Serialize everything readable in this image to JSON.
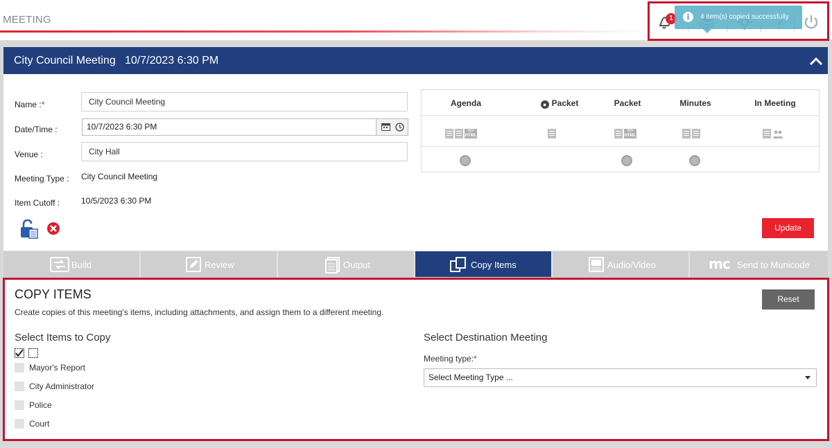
{
  "app": {
    "title": "MEETING"
  },
  "toolbar": {
    "notification_count": "1",
    "toast_message": "4 item(s) copied successfully",
    "icons": [
      "bell-icon",
      "layers-icon",
      "gear-icon",
      "help-icon",
      "power-icon"
    ]
  },
  "meeting": {
    "header_title": "City Council Meeting",
    "header_date": "10/7/2023 6:30 PM",
    "labels": {
      "name": "Name :",
      "required_mark": "*",
      "datetime": "Date/Time :",
      "venue": "Venue :",
      "meeting_type": "Meeting Type :",
      "item_cutoff": "Item Cutoff :"
    },
    "values": {
      "name": "City Council Meeting",
      "datetime": "10/7/2023 6:30 PM",
      "venue": "City Hall",
      "meeting_type": "City Council Meeting",
      "item_cutoff": "10/5/2023 6:30 PM"
    },
    "outputs": {
      "columns": [
        "Agenda",
        "Packet",
        "Packet",
        "Minutes",
        "In Meeting"
      ]
    },
    "update_label": "Update"
  },
  "tabs": [
    {
      "label": "Build",
      "icon": "build-icon"
    },
    {
      "label": "Review",
      "icon": "edit-icon"
    },
    {
      "label": "Output",
      "icon": "document-icon"
    },
    {
      "label": "Copy Items",
      "icon": "copy-icon",
      "active": true
    },
    {
      "label": "Audio/Video",
      "icon": "video-icon"
    },
    {
      "label": "Send to Municode",
      "icon": "municode-logo-icon",
      "logo_text": "mc"
    }
  ],
  "copy_items": {
    "title": "COPY ITEMS",
    "description": "Create copies of this meeting's items, including attachments, and assign them to a different meeting.",
    "reset_label": "Reset",
    "select_items_heading": "Select Items to Copy",
    "items": [
      "Mayor's Report",
      "City Administrator",
      "Police",
      "Court"
    ],
    "destination_heading": "Select Destination Meeting",
    "meeting_type_label": "Meeting type:",
    "required_mark": "*",
    "meeting_type_selected": "Select Meeting Type ..."
  },
  "colors": {
    "header_blue": "#213f7d",
    "accent_red": "#e8232f",
    "toast_teal": "#5bb0c8"
  }
}
